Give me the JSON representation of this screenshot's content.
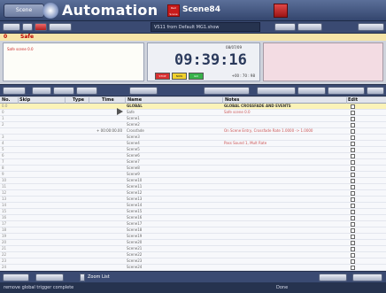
{
  "app": {
    "title": "Automation",
    "logo_label": "Scene",
    "scene_badge_label": "Red Scene",
    "scene_name": "Scene84"
  },
  "toolbar": {
    "show_field": "VS11 from Default MG1.show"
  },
  "status": {
    "number": "0",
    "state": "Safe"
  },
  "info_panel": {
    "text": "Safe scene 0.0"
  },
  "clock": {
    "date": "08/07/09",
    "time": "09:39:16",
    "stop_label": "STOP",
    "now_label": "NOW",
    "go_label": "GO",
    "countdown": "+00 : 70 : 98"
  },
  "columns": {
    "no": "No.",
    "skip": "Skip",
    "type": "Type",
    "time": "Time",
    "name": "Name",
    "notes": "Notes",
    "edit": "Edit"
  },
  "rows": [
    {
      "no": "0.0",
      "name": "GLOBAL",
      "notes": "GLOBAL CROSSFADE AND EVENTS",
      "global": true
    },
    {
      "no": "0",
      "name": "Safe",
      "notes": "Safe scene 0.0"
    },
    {
      "no": "1",
      "name": "Scene1",
      "notes": ""
    },
    {
      "no": "2",
      "name": "Scene2",
      "notes": ""
    },
    {
      "no": "",
      "time": "+ 00:00:00.00",
      "name": "Crossfade",
      "notes": "On Scene Entry, Crossfade Rate 1.0000 -> 1.0000",
      "marker": true
    },
    {
      "no": "3",
      "name": "Scene3",
      "notes": ""
    },
    {
      "no": "4",
      "name": "Scene4",
      "notes": "Pass Sound 1, Mult Rate"
    },
    {
      "no": "5",
      "name": "Scene5",
      "notes": ""
    },
    {
      "no": "6",
      "name": "Scene6",
      "notes": ""
    },
    {
      "no": "7",
      "name": "Scene7",
      "notes": ""
    },
    {
      "no": "8",
      "name": "Scene8",
      "notes": ""
    },
    {
      "no": "9",
      "name": "Scene9",
      "notes": ""
    },
    {
      "no": "10",
      "name": "Scene10",
      "notes": ""
    },
    {
      "no": "11",
      "name": "Scene11",
      "notes": ""
    },
    {
      "no": "12",
      "name": "Scene12",
      "notes": ""
    },
    {
      "no": "13",
      "name": "Scene13",
      "notes": ""
    },
    {
      "no": "14",
      "name": "Scene14",
      "notes": ""
    },
    {
      "no": "15",
      "name": "Scene15",
      "notes": ""
    },
    {
      "no": "16",
      "name": "Scene16",
      "notes": ""
    },
    {
      "no": "17",
      "name": "Scene17",
      "notes": ""
    },
    {
      "no": "18",
      "name": "Scene18",
      "notes": ""
    },
    {
      "no": "19",
      "name": "Scene19",
      "notes": ""
    },
    {
      "no": "20",
      "name": "Scene20",
      "notes": ""
    },
    {
      "no": "21",
      "name": "Scene21",
      "notes": ""
    },
    {
      "no": "22",
      "name": "Scene22",
      "notes": ""
    },
    {
      "no": "23",
      "name": "Scene23",
      "notes": ""
    },
    {
      "no": "24",
      "name": "Scene24",
      "notes": ""
    }
  ],
  "bottom": {
    "zoom_label": "Zoom List"
  },
  "statusbar": {
    "message": "remove global trigger complete",
    "right_message": "Done"
  }
}
